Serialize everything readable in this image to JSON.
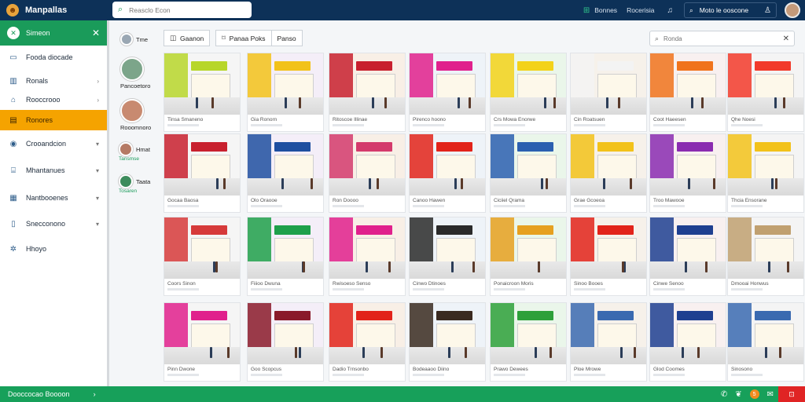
{
  "app": {
    "title": "Manpallas",
    "search_placeholder": "Reasclo Econ"
  },
  "topbar": {
    "links": [
      {
        "icon": "grid-icon",
        "label": "Bonnes"
      },
      {
        "icon": "",
        "label": "Rocerisia"
      }
    ],
    "account_label": "Moto le ooscone"
  },
  "sidebar": {
    "header": "Simeon",
    "items": [
      {
        "icon": "monitor-icon",
        "label": "Fooda diocade",
        "chevron": false,
        "active": false
      },
      {
        "icon": "building-icon",
        "label": "Ronals",
        "chevron": true,
        "active": false
      },
      {
        "icon": "store-icon",
        "label": "Rooccrooo",
        "chevron": true,
        "active": false
      },
      {
        "icon": "list-icon",
        "label": "Ronores",
        "chevron": false,
        "active": true
      },
      {
        "icon": "globe-icon",
        "label": "Crooandcion",
        "chevron": true,
        "active": false
      },
      {
        "icon": "ticket-icon",
        "label": "Mhantanues",
        "chevron": true,
        "active": false
      },
      {
        "icon": "table-icon",
        "label": "Nantbooenes",
        "chevron": true,
        "active": false
      },
      {
        "icon": "file-icon",
        "label": "Snecconono",
        "chevron": true,
        "active": false
      },
      {
        "icon": "settings-icon",
        "label": "Hhoyo",
        "chevron": false,
        "active": false
      }
    ]
  },
  "people": [
    {
      "name": "Tme",
      "sub": ""
    },
    {
      "name": "Pancoetoro",
      "sub": ""
    },
    {
      "name": "Rooomnoro",
      "sub": ""
    },
    {
      "name": "Hmat",
      "sub": "Tansmse"
    },
    {
      "name": "Taata",
      "sub": "Tosaren"
    }
  ],
  "filters": [
    {
      "icon": "filter-icon",
      "label": "Gaanon"
    },
    {
      "icon": "tag-icon",
      "label": "Panaa Poks"
    },
    {
      "icon": "",
      "label": "Panso"
    }
  ],
  "list_search": {
    "placeholder": "Ronda"
  },
  "cards": [
    {
      "caption": "Tinsa Smaneno"
    },
    {
      "caption": "Gia Ronorn"
    },
    {
      "caption": "Ritoscoe Illinae"
    },
    {
      "caption": "Pirenco hoono"
    },
    {
      "caption": "Crs Mowa Enorwe"
    },
    {
      "caption": "Cin Roatsuen"
    },
    {
      "caption": "Coot Haeesen"
    },
    {
      "caption": "Qhe Noesi"
    },
    {
      "caption": "Gocaa Baosa"
    },
    {
      "caption": "Olo Oraooe"
    },
    {
      "caption": "Ron Doooo"
    },
    {
      "caption": "Canoo Hawen"
    },
    {
      "caption": "Ciciiel Qrama"
    },
    {
      "caption": "Grae Gcoeoa"
    },
    {
      "caption": "Troo Mawooe"
    },
    {
      "caption": "Thcia Ensorane"
    },
    {
      "caption": "Coors Sinon"
    },
    {
      "caption": "Fiiioo Dwuna"
    },
    {
      "caption": "Rwisoeso Senso"
    },
    {
      "caption": "Cinwo Dtinoes"
    },
    {
      "caption": "Ponaicroon Moris"
    },
    {
      "caption": "Sinoo Booes"
    },
    {
      "caption": "Cinwe Senoo"
    },
    {
      "caption": "Dmooai Honwus"
    },
    {
      "caption": "Pinn Dwone"
    },
    {
      "caption": "Goo Scopcus"
    },
    {
      "caption": "Dadio Trnsonbo"
    },
    {
      "caption": "Bodeaaoo Diino"
    },
    {
      "caption": "Prawo Dewees"
    },
    {
      "caption": "Ploe Mrowe"
    },
    {
      "caption": "Glod Coomes"
    },
    {
      "caption": "Sinosono"
    }
  ],
  "statusbar": {
    "label": "Dooccocao Boooon",
    "badge": "5"
  },
  "colors": {
    "topbar": "#0d3158",
    "accent_green": "#1a9b5a",
    "active_orange": "#f5a300",
    "alert_red": "#e02424"
  }
}
